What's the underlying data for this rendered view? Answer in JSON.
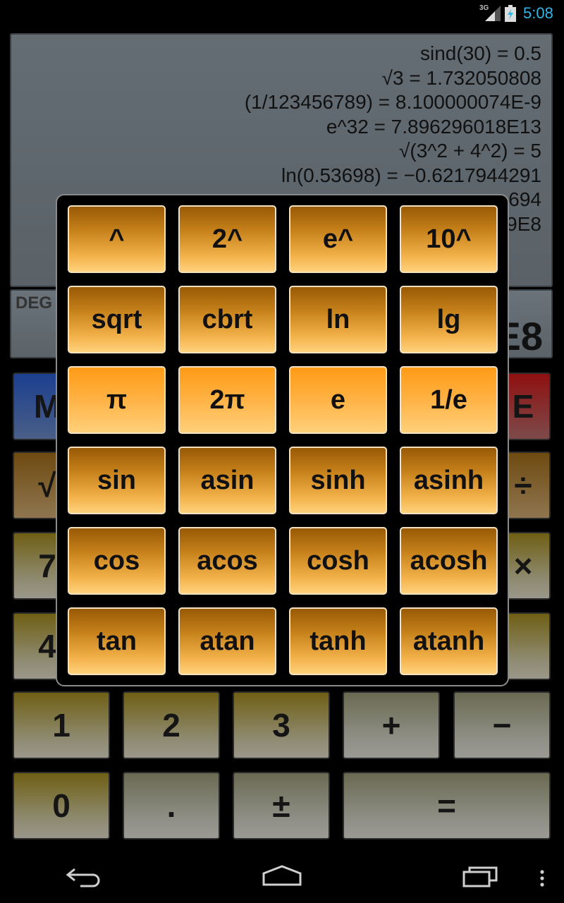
{
  "status_bar": {
    "network": "3G",
    "time": "5:08",
    "icons": [
      "signal-icon",
      "battery-charging-icon"
    ]
  },
  "history": {
    "lines": [
      "sind(30) = 0.5",
      "√3 = 1.732050808",
      "(1/123456789) = 8.100000074E-9",
      "e^32 = 7.896296018E13",
      "√(3^2 + 4^2) = 5",
      "ln(0.53698) = −0.6217944291",
      "694",
      "9E8"
    ]
  },
  "result": {
    "mode": "DEG",
    "value": "E8"
  },
  "keypad": {
    "row1": [
      "M",
      "E"
    ],
    "row2": [
      "√",
      "÷"
    ],
    "row3": [
      "7",
      "×"
    ],
    "row4": [
      "4",
      ""
    ],
    "row5": [
      "1",
      "2",
      "3",
      "+",
      "−"
    ],
    "row6": [
      "0",
      ".",
      "±",
      "="
    ]
  },
  "popup": {
    "buttons": [
      [
        "^",
        "2^",
        "e^",
        "10^"
      ],
      [
        "sqrt",
        "cbrt",
        "ln",
        "lg"
      ],
      [
        "π",
        "2π",
        "e",
        "1/e"
      ],
      [
        "sin",
        "asin",
        "sinh",
        "asinh"
      ],
      [
        "cos",
        "acos",
        "cosh",
        "acosh"
      ],
      [
        "tan",
        "atan",
        "tanh",
        "atanh"
      ]
    ]
  },
  "navigation": {
    "icons": [
      "back-icon",
      "home-icon",
      "recent-apps-icon",
      "overflow-menu-icon"
    ]
  },
  "colors": {
    "accent": "#33b5e5",
    "function_key": "#f2b048",
    "constant_key": "#ff9b16"
  }
}
